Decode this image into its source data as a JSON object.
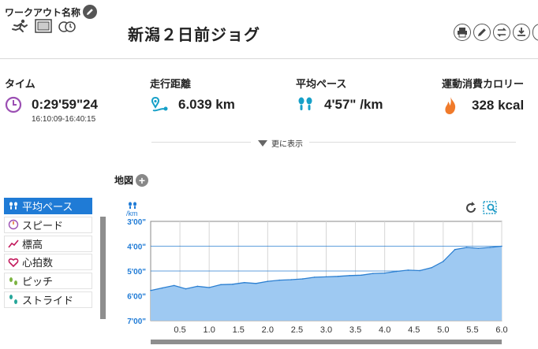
{
  "header": {
    "workout_name_label": "ワークアウト名称",
    "title": "新潟２日前ジョグ"
  },
  "stats": {
    "time": {
      "label": "タイム",
      "value": "0:29'59\"24",
      "range": "16:10:09-16:40:15"
    },
    "distance": {
      "label": "走行距離",
      "value": "6.039 km"
    },
    "pace": {
      "label": "平均ペース",
      "value": "4'57\" /km"
    },
    "calories": {
      "label": "運動消費カロリー",
      "value": "328 kcal"
    }
  },
  "more": {
    "label": "更に表示"
  },
  "map": {
    "label": "地図"
  },
  "metrics": [
    {
      "label": "平均ペース",
      "icon": "footsteps-icon",
      "active": true
    },
    {
      "label": "スピード",
      "icon": "speedometer-icon",
      "active": false
    },
    {
      "label": "標高",
      "icon": "elevation-icon",
      "active": false
    },
    {
      "label": "心拍数",
      "icon": "heart-icon",
      "active": false
    },
    {
      "label": "ピッチ",
      "icon": "pitch-icon",
      "active": false
    },
    {
      "label": "ストライド",
      "icon": "stride-icon",
      "active": false
    }
  ],
  "colors": {
    "accent": "#1f7bd6",
    "purple": "#9b4fb3",
    "teal": "#16a0c8",
    "orange": "#f07a2a",
    "chart_fill": "#9ec9f2",
    "chart_line": "#2b7fd1",
    "chart_bg": "#ffffff"
  },
  "chart_data": {
    "type": "area",
    "ylabel": "/km",
    "y_ticks": [
      "3'00\"",
      "4'00\"",
      "5'00\"",
      "6'00\"",
      "7'00\""
    ],
    "y_tick_values": [
      180,
      240,
      300,
      360,
      420
    ],
    "ylim": [
      420,
      180
    ],
    "x_ticks": [
      "0.5",
      "1.0",
      "1.5",
      "2.0",
      "2.5",
      "3.0",
      "3.5",
      "4.0",
      "4.5",
      "5.0",
      "5.5",
      "6.0"
    ],
    "xlim": [
      0,
      6.0
    ],
    "grid": true,
    "x": [
      0.0,
      0.2,
      0.4,
      0.6,
      0.8,
      1.0,
      1.2,
      1.4,
      1.6,
      1.8,
      2.0,
      2.2,
      2.4,
      2.6,
      2.8,
      3.0,
      3.2,
      3.4,
      3.6,
      3.8,
      4.0,
      4.2,
      4.4,
      4.6,
      4.8,
      5.0,
      5.2,
      5.4,
      5.6,
      5.8,
      6.0
    ],
    "values": [
      347,
      341,
      335,
      343,
      337,
      340,
      333,
      332,
      328,
      330,
      325,
      322,
      321,
      319,
      315,
      314,
      313,
      311,
      310,
      306,
      305,
      301,
      298,
      299,
      292,
      277,
      248,
      243,
      245,
      243,
      240
    ]
  }
}
